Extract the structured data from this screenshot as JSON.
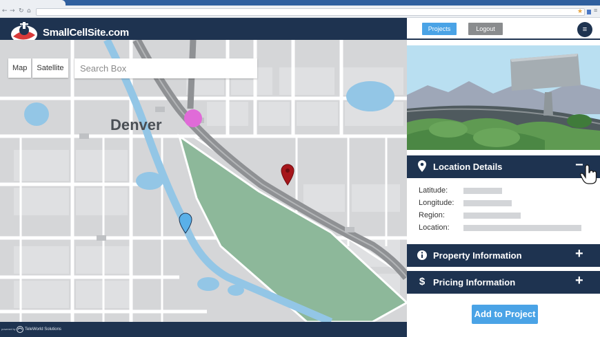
{
  "app": {
    "brand_name": "SmallCellSite.com",
    "colors": {
      "header": "#1e3350",
      "accent": "#4aa3e6",
      "logout": "#8a8c8e"
    }
  },
  "map": {
    "type_buttons": [
      "Map",
      "Satellite"
    ],
    "search_placeholder": "Search Box",
    "city_label": "Denver",
    "markers": [
      "magenta-circle-marker",
      "red-pin-marker",
      "blue-pin-marker"
    ]
  },
  "footer": {
    "powered_by": "powered by",
    "company": "TeleWorld Solutions"
  },
  "panel": {
    "projects_label": "Projects",
    "logout_label": "Logout",
    "menu_icon": "hamburger-icon",
    "sections": {
      "location": {
        "title": "Location Details",
        "icon": "location-pin-icon",
        "toggle": "−"
      },
      "property": {
        "title": "Property Information",
        "icon": "info-icon",
        "toggle": "+"
      },
      "pricing": {
        "title": "Pricing Information",
        "icon": "dollar-icon",
        "toggle": "+"
      }
    },
    "location_fields": [
      {
        "label": "Latitude:"
      },
      {
        "label": "Longitude:"
      },
      {
        "label": "Region:"
      },
      {
        "label": "Location:"
      }
    ],
    "add_button": "Add to Project"
  }
}
